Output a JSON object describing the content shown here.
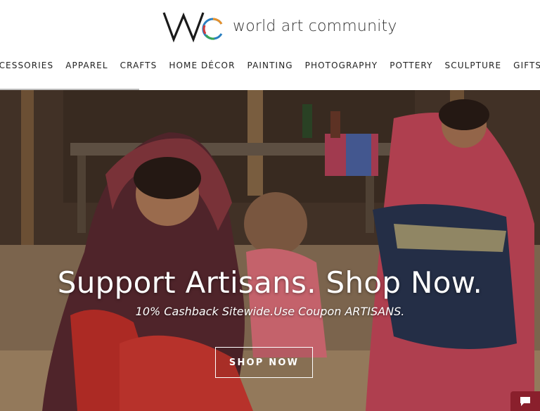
{
  "brand": {
    "name": "world art community"
  },
  "nav": {
    "items": [
      "ACCESSORIES",
      "APPAREL",
      "CRAFTS",
      "HOME DÉCOR",
      "PAINTING",
      "PHOTOGRAPHY",
      "POTTERY",
      "SCULPTURE",
      "GIFTS"
    ]
  },
  "hero": {
    "title": "Support Artisans. Shop Now.",
    "subtitle": "10% Cashback Sitewide.Use Coupon ARTISANS.",
    "cta_label": "SHOP NOW"
  },
  "chat": {
    "icon": "chat-icon"
  },
  "colors": {
    "chat_bg": "#8a1f2c",
    "logo_blue": "#2a7fc1",
    "logo_orange": "#e8912a",
    "logo_green": "#3aa655",
    "logo_red": "#d23a3a"
  }
}
